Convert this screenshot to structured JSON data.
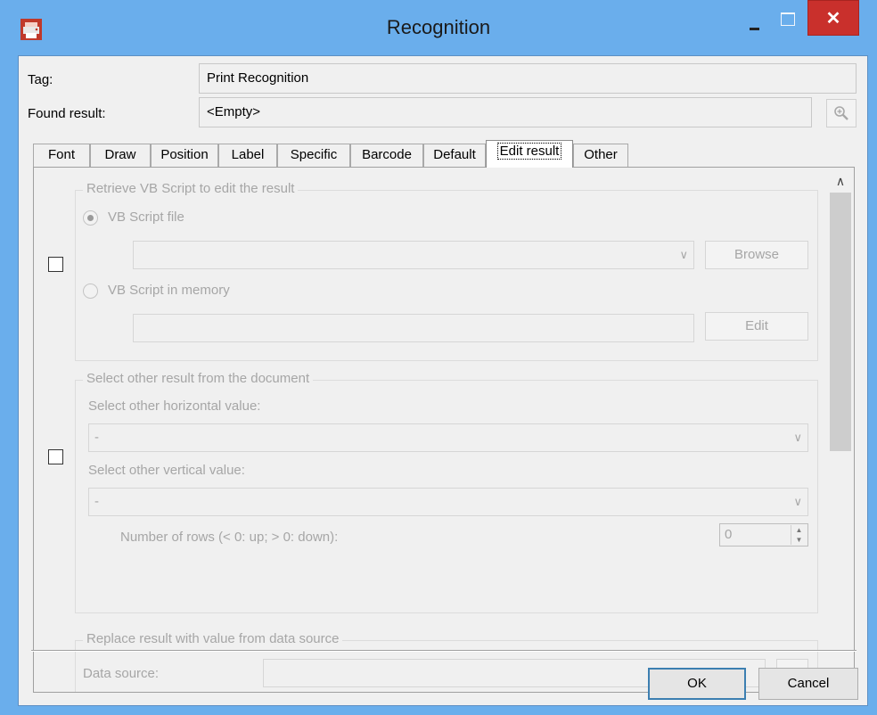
{
  "window": {
    "title": "Recognition",
    "close_glyph": "✕"
  },
  "form": {
    "tag_label": "Tag:",
    "tag_value": "Print Recognition",
    "found_label": "Found result:",
    "found_value": "<Empty>"
  },
  "tabs": [
    {
      "label": "Font"
    },
    {
      "label": "Draw"
    },
    {
      "label": "Position"
    },
    {
      "label": "Label"
    },
    {
      "label": "Specific"
    },
    {
      "label": "Barcode"
    },
    {
      "label": "Default"
    },
    {
      "label": "Edit result"
    },
    {
      "label": "Other"
    }
  ],
  "active_tab": "Edit result",
  "vb_group": {
    "legend": "Retrieve VB Script to edit the result",
    "file_radio": "VB Script file",
    "memory_radio": "VB Script in memory",
    "browse_button": "Browse",
    "edit_button": "Edit"
  },
  "select_group": {
    "legend": "Select other result from the document",
    "horizontal_label": "Select other horizontal value:",
    "horizontal_value": "-",
    "vertical_label": "Select other vertical value:",
    "vertical_value": "-",
    "rows_label": "Number of rows (< 0: up; > 0: down):",
    "rows_value": "0"
  },
  "replace_group": {
    "legend": "Replace result with value from data source",
    "data_source_label": "Data source:",
    "ellipsis_button": "..."
  },
  "buttons": {
    "ok": "OK",
    "cancel": "Cancel"
  },
  "icons": {
    "app": "app-printer-icon",
    "zoom": "zoom-in-icon",
    "dropdown": "chevron-down-icon",
    "scroll_up": "chevron-up-icon",
    "scroll_down": "chevron-down-icon"
  }
}
